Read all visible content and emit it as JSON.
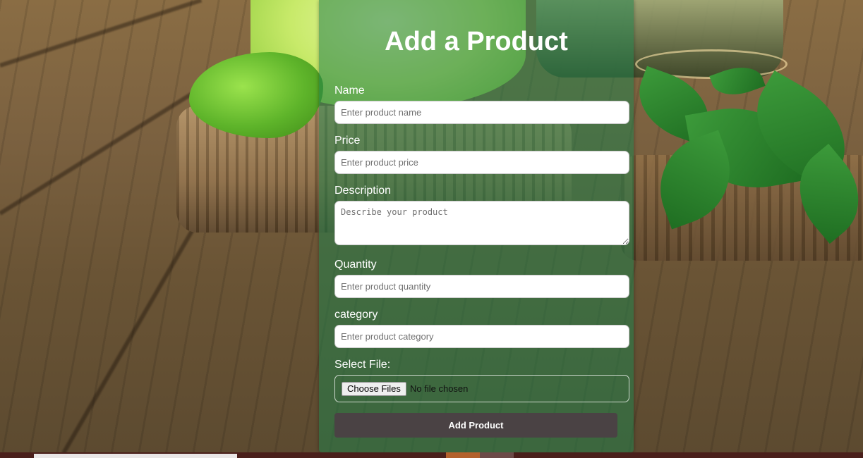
{
  "form": {
    "title": "Add a Product",
    "fields": {
      "name": {
        "label": "Name",
        "placeholder": "Enter product name",
        "value": ""
      },
      "price": {
        "label": "Price",
        "placeholder": "Enter product price",
        "value": ""
      },
      "description": {
        "label": "Description",
        "placeholder": "Describe your product",
        "value": ""
      },
      "quantity": {
        "label": "Quantity",
        "placeholder": "Enter product quantity",
        "value": ""
      },
      "category": {
        "label": "category",
        "placeholder": "Enter product category",
        "value": ""
      }
    },
    "file": {
      "label": "Select File:",
      "button_label": "Choose Files",
      "status": "No file chosen"
    },
    "submit_label": "Add Product"
  },
  "colors": {
    "panel_overlay": "#21804a",
    "submit_button": "#4a4244",
    "text": "#ffffff"
  },
  "background": {
    "image": "limes-on-wooden-table-photo"
  }
}
